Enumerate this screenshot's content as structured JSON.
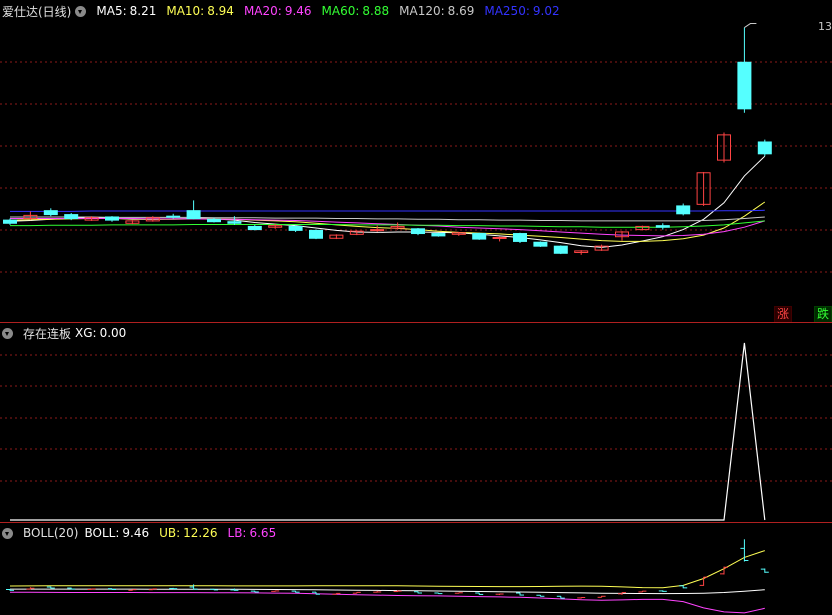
{
  "main_panel": {
    "stock_name": "爱仕达(日线)",
    "indicators": [
      {
        "label": "MA5:",
        "value": "8.21",
        "color": "#ffffff"
      },
      {
        "label": "MA10:",
        "value": "8.94",
        "color": "#ffff55"
      },
      {
        "label": "MA20:",
        "value": "9.46",
        "color": "#ff44ff"
      },
      {
        "label": "MA60:",
        "value": "8.88",
        "color": "#33ff33"
      },
      {
        "label": "MA120:",
        "value": "8.69",
        "color": "#c8c8c8"
      },
      {
        "label": "MA250:",
        "value": "9.02",
        "color": "#3333ff"
      }
    ],
    "high_label": "13",
    "rise_button": "涨",
    "fall_button": "跌"
  },
  "sub_panel_1": {
    "title": "存在连板",
    "indicator_label": "XG:",
    "indicator_value": "0.00"
  },
  "sub_panel_2": {
    "title": "BOLL(20)",
    "indicators": [
      {
        "label": "BOLL:",
        "value": "9.46",
        "color": "#ffffff"
      },
      {
        "label": "UB:",
        "value": "12.26",
        "color": "#ffff55"
      },
      {
        "label": "LB:",
        "value": "6.65",
        "color": "#ff44ff"
      }
    ]
  },
  "colors": {
    "background": "#000000",
    "up_candle": "#ff4444",
    "down_candle": "#55ffff",
    "grid": "#8b1a1a",
    "separator": "#b02020"
  },
  "chart_data": [
    {
      "type": "candlestick",
      "title": "爱仕达(日线)",
      "grid": true,
      "ylim": [
        6.0,
        13.5
      ],
      "candles": [
        {
          "o": 8.48,
          "c": 8.4,
          "h": 8.52,
          "l": 8.36
        },
        {
          "o": 8.52,
          "c": 8.6,
          "h": 8.7,
          "l": 8.48
        },
        {
          "o": 8.72,
          "c": 8.62,
          "h": 8.78,
          "l": 8.58
        },
        {
          "o": 8.62,
          "c": 8.52,
          "h": 8.66,
          "l": 8.48
        },
        {
          "o": 8.48,
          "c": 8.54,
          "h": 8.58,
          "l": 8.46
        },
        {
          "o": 8.56,
          "c": 8.48,
          "h": 8.58,
          "l": 8.44
        },
        {
          "o": 8.4,
          "c": 8.46,
          "h": 8.48,
          "l": 8.38
        },
        {
          "o": 8.46,
          "c": 8.54,
          "h": 8.58,
          "l": 8.44
        },
        {
          "o": 8.58,
          "c": 8.56,
          "h": 8.64,
          "l": 8.52
        },
        {
          "o": 8.72,
          "c": 8.52,
          "h": 8.98,
          "l": 8.5
        },
        {
          "o": 8.5,
          "c": 8.44,
          "h": 8.54,
          "l": 8.42
        },
        {
          "o": 8.44,
          "c": 8.4,
          "h": 8.58,
          "l": 8.36
        },
        {
          "o": 8.32,
          "c": 8.24,
          "h": 8.36,
          "l": 8.22
        },
        {
          "o": 8.3,
          "c": 8.34,
          "h": 8.38,
          "l": 8.26
        },
        {
          "o": 8.32,
          "c": 8.22,
          "h": 8.34,
          "l": 8.18
        },
        {
          "o": 8.22,
          "c": 8.02,
          "h": 8.24,
          "l": 8.0
        },
        {
          "o": 8.02,
          "c": 8.1,
          "h": 8.12,
          "l": 8.0
        },
        {
          "o": 8.12,
          "c": 8.2,
          "h": 8.22,
          "l": 8.1
        },
        {
          "o": 8.22,
          "c": 8.24,
          "h": 8.34,
          "l": 8.18
        },
        {
          "o": 8.28,
          "c": 8.32,
          "h": 8.42,
          "l": 8.24
        },
        {
          "o": 8.26,
          "c": 8.14,
          "h": 8.28,
          "l": 8.1
        },
        {
          "o": 8.14,
          "c": 8.08,
          "h": 8.16,
          "l": 8.06
        },
        {
          "o": 8.12,
          "c": 8.16,
          "h": 8.18,
          "l": 8.08
        },
        {
          "o": 8.14,
          "c": 8.0,
          "h": 8.16,
          "l": 7.98
        },
        {
          "o": 8.02,
          "c": 8.04,
          "h": 8.06,
          "l": 7.94
        },
        {
          "o": 8.14,
          "c": 7.94,
          "h": 8.16,
          "l": 7.9
        },
        {
          "o": 7.92,
          "c": 7.82,
          "h": 7.94,
          "l": 7.8
        },
        {
          "o": 7.82,
          "c": 7.64,
          "h": 7.84,
          "l": 7.62
        },
        {
          "o": 7.66,
          "c": 7.7,
          "h": 7.72,
          "l": 7.6
        },
        {
          "o": 7.72,
          "c": 7.82,
          "h": 7.86,
          "l": 7.7
        },
        {
          "o": 8.06,
          "c": 8.18,
          "h": 8.2,
          "l": 7.96
        },
        {
          "o": 8.24,
          "c": 8.32,
          "h": 8.34,
          "l": 8.22
        },
        {
          "o": 8.34,
          "c": 8.3,
          "h": 8.4,
          "l": 8.24
        },
        {
          "o": 8.84,
          "c": 8.64,
          "h": 8.9,
          "l": 8.6
        },
        {
          "o": 8.88,
          "c": 9.68,
          "h": 9.7,
          "l": 8.84
        },
        {
          "o": 10.0,
          "c": 10.64,
          "h": 10.7,
          "l": 9.94
        },
        {
          "o": 12.48,
          "c": 11.3,
          "h": 13.36,
          "l": 11.2
        },
        {
          "o": 10.46,
          "c": 10.16,
          "h": 10.52,
          "l": 10.1
        }
      ],
      "ma": [
        {
          "name": "MA5",
          "color": "#ffffff",
          "values": [
            8.45,
            8.47,
            8.5,
            8.53,
            8.55,
            8.53,
            8.5,
            8.5,
            8.51,
            8.52,
            8.51,
            8.48,
            8.42,
            8.38,
            8.34,
            8.28,
            8.22,
            8.18,
            8.17,
            8.18,
            8.18,
            8.17,
            8.16,
            8.12,
            8.08,
            8.04,
            7.98,
            7.91,
            7.83,
            7.79,
            7.85,
            7.95,
            8.06,
            8.24,
            8.5,
            8.92,
            9.6,
            10.1
          ]
        },
        {
          "name": "MA10",
          "color": "#ffff55",
          "values": [
            8.48,
            8.49,
            8.5,
            8.51,
            8.52,
            8.52,
            8.51,
            8.5,
            8.5,
            8.51,
            8.51,
            8.5,
            8.48,
            8.46,
            8.44,
            8.4,
            8.36,
            8.32,
            8.29,
            8.27,
            8.24,
            8.2,
            8.17,
            8.15,
            8.13,
            8.1,
            8.07,
            8.04,
            8.0,
            7.96,
            7.94,
            7.94,
            7.96,
            8.01,
            8.1,
            8.28,
            8.58,
            8.94
          ]
        },
        {
          "name": "MA20",
          "color": "#ff44ff",
          "values": [
            8.52,
            8.52,
            8.52,
            8.52,
            8.52,
            8.52,
            8.52,
            8.51,
            8.51,
            8.51,
            8.5,
            8.5,
            8.49,
            8.48,
            8.47,
            8.45,
            8.43,
            8.41,
            8.39,
            8.37,
            8.35,
            8.33,
            8.3,
            8.28,
            8.26,
            8.24,
            8.21,
            8.18,
            8.15,
            8.12,
            8.1,
            8.09,
            8.08,
            8.09,
            8.12,
            8.19,
            8.3,
            8.46
          ]
        },
        {
          "name": "MA60",
          "color": "#33ff33",
          "values": [
            8.34,
            8.34,
            8.35,
            8.35,
            8.35,
            8.36,
            8.36,
            8.36,
            8.36,
            8.37,
            8.37,
            8.37,
            8.37,
            8.37,
            8.37,
            8.37,
            8.37,
            8.36,
            8.36,
            8.36,
            8.35,
            8.35,
            8.34,
            8.34,
            8.33,
            8.33,
            8.32,
            8.31,
            8.31,
            8.3,
            8.3,
            8.3,
            8.3,
            8.31,
            8.33,
            8.36,
            8.41,
            8.46
          ]
        },
        {
          "name": "MA120",
          "color": "#c8c8c8",
          "values": [
            8.56,
            8.56,
            8.56,
            8.56,
            8.56,
            8.55,
            8.55,
            8.55,
            8.55,
            8.55,
            8.54,
            8.54,
            8.54,
            8.53,
            8.53,
            8.53,
            8.52,
            8.52,
            8.51,
            8.51,
            8.5,
            8.5,
            8.49,
            8.49,
            8.48,
            8.48,
            8.47,
            8.47,
            8.46,
            8.46,
            8.46,
            8.46,
            8.46,
            8.46,
            8.47,
            8.49,
            8.52,
            8.56
          ]
        },
        {
          "name": "MA250",
          "color": "#3333ff",
          "values": [
            8.7,
            8.7,
            8.7,
            8.7,
            8.71,
            8.71,
            8.71,
            8.71,
            8.71,
            8.71,
            8.71,
            8.71,
            8.71,
            8.71,
            8.71,
            8.71,
            8.71,
            8.71,
            8.71,
            8.71,
            8.71,
            8.71,
            8.71,
            8.71,
            8.71,
            8.71,
            8.71,
            8.71,
            8.71,
            8.71,
            8.71,
            8.71,
            8.71,
            8.71,
            8.71,
            8.72,
            8.72,
            8.73
          ]
        }
      ]
    },
    {
      "type": "line",
      "title": "存在连板",
      "grid": true,
      "ylim": [
        0,
        1
      ],
      "series": [
        {
          "name": "XG",
          "color": "#ffffff",
          "values": [
            0,
            0,
            0,
            0,
            0,
            0,
            0,
            0,
            0,
            0,
            0,
            0,
            0,
            0,
            0,
            0,
            0,
            0,
            0,
            0,
            0,
            0,
            0,
            0,
            0,
            0,
            0,
            0,
            0,
            0,
            0,
            0,
            0,
            0,
            0,
            0,
            1,
            0
          ]
        }
      ]
    },
    {
      "type": "line",
      "title": "BOLL(20)",
      "ylim": [
        6.0,
        13.0
      ],
      "series": [
        {
          "name": "BOLL",
          "color": "#ffffff",
          "values": [
            8.52,
            8.52,
            8.52,
            8.52,
            8.52,
            8.52,
            8.52,
            8.51,
            8.51,
            8.51,
            8.5,
            8.5,
            8.49,
            8.48,
            8.47,
            8.45,
            8.43,
            8.41,
            8.39,
            8.37,
            8.35,
            8.33,
            8.3,
            8.28,
            8.26,
            8.24,
            8.21,
            8.18,
            8.15,
            8.12,
            8.1,
            8.09,
            8.08,
            8.09,
            8.12,
            8.19,
            8.3,
            8.46
          ]
        },
        {
          "name": "UB",
          "color": "#ffff55",
          "values": [
            8.82,
            8.83,
            8.84,
            8.85,
            8.85,
            8.85,
            8.85,
            8.84,
            8.84,
            8.84,
            8.84,
            8.83,
            8.83,
            8.83,
            8.83,
            8.84,
            8.85,
            8.85,
            8.85,
            8.84,
            8.82,
            8.8,
            8.78,
            8.77,
            8.76,
            8.76,
            8.77,
            8.79,
            8.81,
            8.8,
            8.73,
            8.66,
            8.64,
            8.88,
            9.55,
            10.5,
            11.6,
            12.26
          ]
        },
        {
          "name": "LB",
          "color": "#ff44ff",
          "values": [
            8.22,
            8.21,
            8.2,
            8.19,
            8.19,
            8.19,
            8.19,
            8.18,
            8.18,
            8.18,
            8.16,
            8.17,
            8.15,
            8.13,
            8.11,
            8.06,
            8.01,
            7.97,
            7.93,
            7.9,
            7.88,
            7.86,
            7.82,
            7.79,
            7.76,
            7.72,
            7.65,
            7.57,
            7.49,
            7.44,
            7.47,
            7.52,
            7.52,
            7.3,
            6.69,
            6.3,
            6.2,
            6.65
          ]
        }
      ]
    }
  ]
}
